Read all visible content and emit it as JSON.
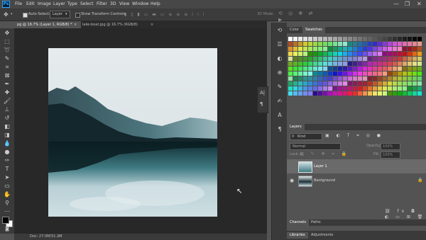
{
  "menubar": {
    "logo": "Ps",
    "items": [
      "File",
      "Edit",
      "Image",
      "Layer",
      "Type",
      "Select",
      "Filter",
      "3D",
      "View",
      "Window",
      "Help"
    ]
  },
  "window_controls": {
    "minimize": "—",
    "restore": "❐",
    "close": "✕"
  },
  "options_bar": {
    "auto_select_label": "Auto-Select:",
    "auto_select_target": "Layer",
    "show_transform_label": "Show Transform Controls",
    "mode_3d": "3D Mode:"
  },
  "tabs": [
    {
      "label": "pg @ 16.7% (Layer 1, RGB/8) *",
      "active": true
    },
    {
      "label": "lake-boat.jpg @ 16.7% (RGB/8)",
      "active": false
    }
  ],
  "status": {
    "doc": "Doc: 27.0M/51.2M"
  },
  "panels": {
    "color_tabs": [
      "Color",
      "Swatches"
    ],
    "layers_title": "Layers",
    "filter_kind": "Kind",
    "blend_mode": "Normal",
    "opacity_label": "Opacity:",
    "opacity_value": "100%",
    "lock_label": "Lock:",
    "fill_label": "Fill:",
    "fill_value": "100%",
    "layers": [
      {
        "name": "Layer 1",
        "selected": true,
        "visible": false
      },
      {
        "name": "Background",
        "selected": false,
        "visible": true
      }
    ],
    "bottom_tabs_1": [
      "Channels",
      "Paths"
    ],
    "bottom_tabs_2": [
      "Libraries",
      "Adjustments"
    ]
  },
  "colors": {
    "app_bg": "#535353",
    "canvas_bg": "#282828",
    "panel_dark": "#3a3a3a",
    "selected_layer": "#6a6a6a"
  }
}
